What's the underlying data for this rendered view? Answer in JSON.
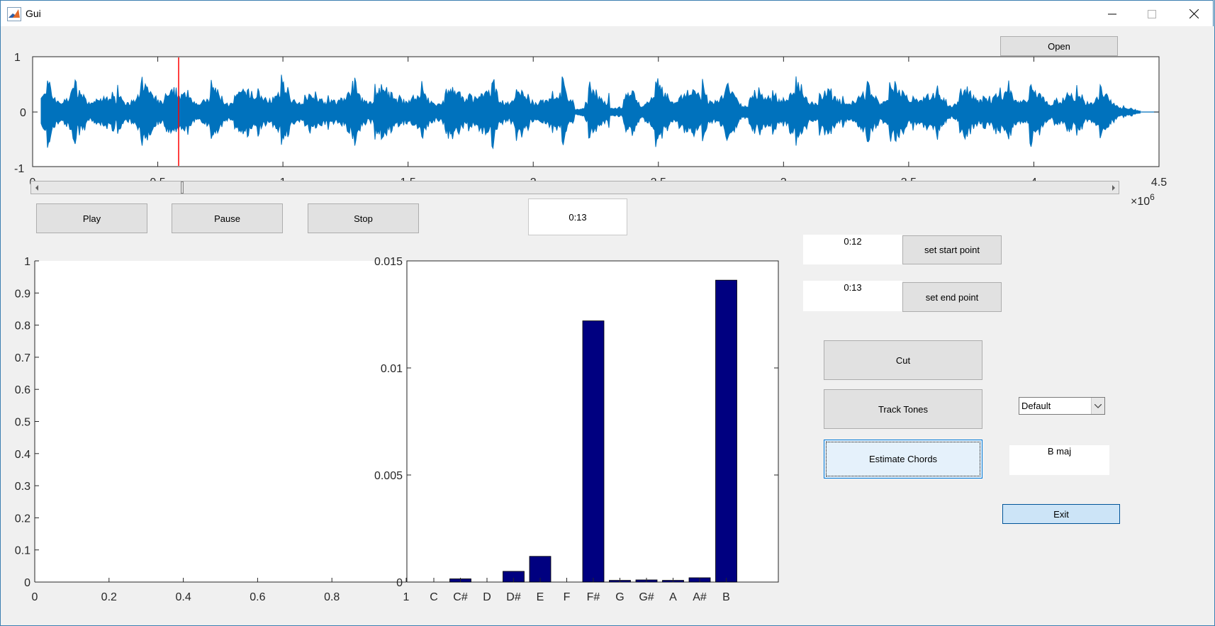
{
  "window": {
    "title": "Gui"
  },
  "buttons": {
    "open": "Open",
    "play": "Play",
    "pause": "Pause",
    "stop": "Stop",
    "set_start": "set start point",
    "set_end": "set end point",
    "cut": "Cut",
    "track_tones": "Track Tones",
    "estimate_chords": "Estimate Chords",
    "exit": "Exit"
  },
  "fields": {
    "current_time": "0:13",
    "start_point": "0:12",
    "end_point": "0:13",
    "chord_result": "B maj"
  },
  "dropdown": {
    "selected": "Default"
  },
  "waveform": {
    "y_ticks": [
      "1",
      "0",
      "-1"
    ],
    "x_ticks": [
      "0",
      "0.5",
      "1",
      "1.5",
      "2",
      "2.5",
      "3",
      "3.5",
      "4",
      "4.5"
    ],
    "x_multiplier_base": "×10",
    "x_multiplier_exp": "6",
    "color": "#0072bd",
    "cursor_color": "#ff0000"
  },
  "slider": {
    "value_fraction": 0.13
  },
  "empty_plot": {
    "y_ticks": [
      "1",
      "0.9",
      "0.8",
      "0.7",
      "0.6",
      "0.5",
      "0.4",
      "0.3",
      "0.2",
      "0.1",
      "0"
    ],
    "x_ticks": [
      "0",
      "0.2",
      "0.4",
      "0.6",
      "0.8",
      "1"
    ]
  },
  "chart_data": {
    "type": "bar",
    "categories": [
      "C",
      "C#",
      "D",
      "D#",
      "E",
      "F",
      "F#",
      "G",
      "G#",
      "A",
      "A#",
      "B"
    ],
    "values": [
      0,
      0.00015,
      0,
      0.0005,
      0.0012,
      0,
      0.0122,
      8e-05,
      0.0001,
      8e-05,
      0.0002,
      0.0141
    ],
    "ylim": [
      0,
      0.015
    ],
    "y_ticks": [
      "0",
      "0.005",
      "0.01",
      "0.015"
    ],
    "bar_color": "#000080"
  }
}
